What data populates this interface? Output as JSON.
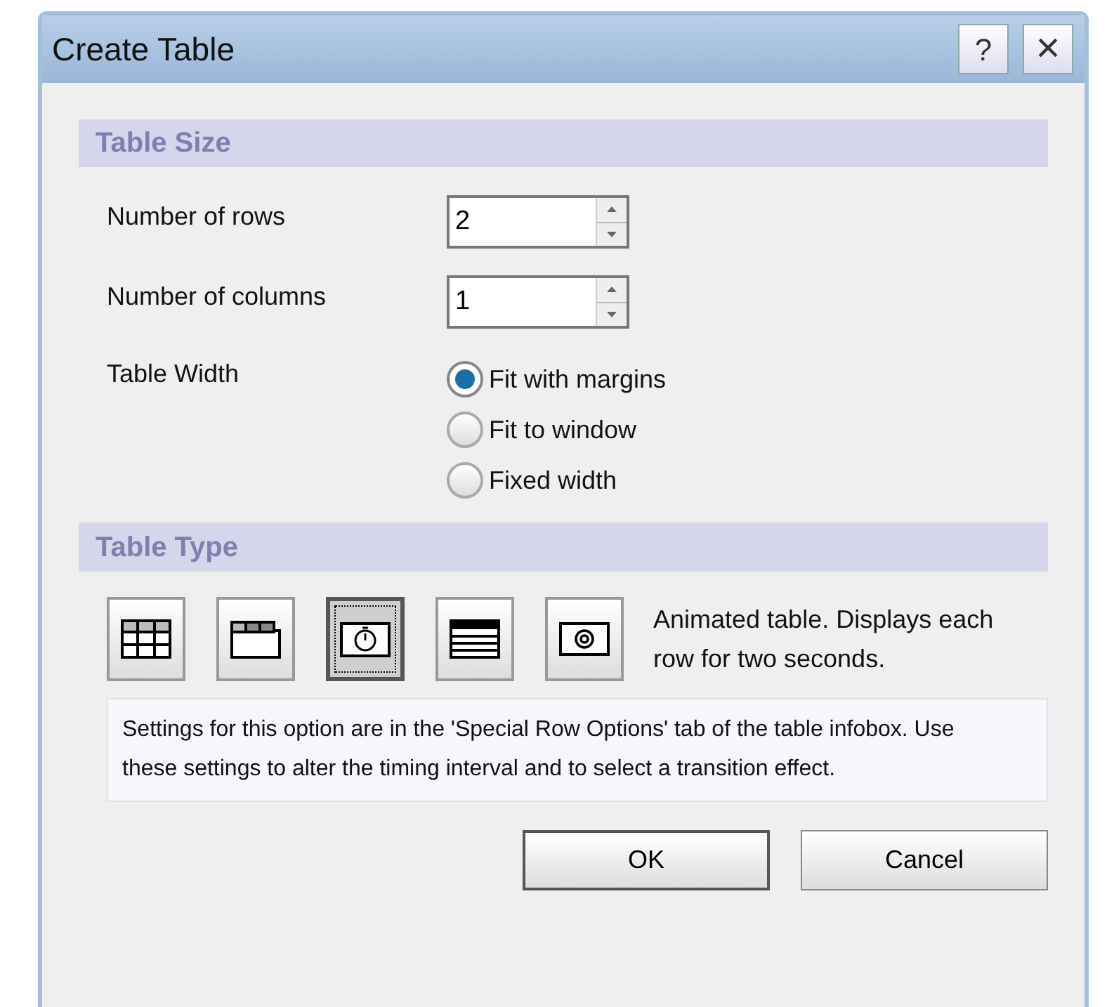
{
  "window": {
    "title": "Create Table",
    "help_button": "?",
    "close_button": "×"
  },
  "table_size": {
    "heading": "Table Size",
    "fields": [
      {
        "label": "Number of rows",
        "value": "2"
      },
      {
        "label": "Number of columns",
        "value": "1"
      }
    ],
    "width_label": "Table Width",
    "width_options": [
      {
        "label": "Fit with margins",
        "selected": true
      },
      {
        "label": "Fit to window",
        "selected": false
      },
      {
        "label": "Fixed width",
        "selected": false
      }
    ]
  },
  "table_type": {
    "heading": "Table Type",
    "types": [
      {
        "kind": "grid",
        "selected": false
      },
      {
        "kind": "header",
        "selected": false
      },
      {
        "kind": "timer",
        "selected": true
      },
      {
        "kind": "striped",
        "selected": false
      },
      {
        "kind": "at",
        "selected": false
      }
    ],
    "description": "Animated table. Displays each row for two seconds.",
    "info": "Settings for this option are in the 'Special Row Options' tab of the table infobox.  Use these settings to alter the timing interval and to select a transition effect."
  },
  "buttons": [
    {
      "label": "OK",
      "default": true
    },
    {
      "label": "Cancel",
      "default": false
    }
  ]
}
